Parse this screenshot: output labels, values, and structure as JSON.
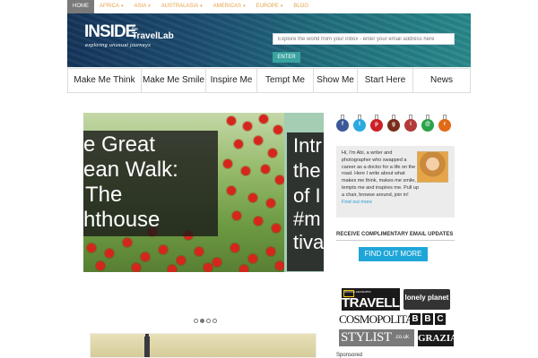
{
  "topnav": {
    "items": [
      {
        "label": "HOME",
        "has_dropdown": false,
        "active": true
      },
      {
        "label": "AFRICA",
        "has_dropdown": true
      },
      {
        "label": "ASIA",
        "has_dropdown": true
      },
      {
        "label": "AUSTRALASIA",
        "has_dropdown": true
      },
      {
        "label": "AMERICAS",
        "has_dropdown": true
      },
      {
        "label": "EUROPE",
        "has_dropdown": true
      },
      {
        "label": "BLOG",
        "has_dropdown": false
      }
    ],
    "dropdown_glyph": "▾"
  },
  "header": {
    "logo_inside": "INSIDE",
    "logo_the": "the",
    "logo_travellab": "TravelLab",
    "logo_tagline": "exploring unusual journeys",
    "email_placeholder": "Explore the world from your inbox - enter your email address here",
    "enter_label": "ENTER"
  },
  "mainnav": {
    "items": [
      {
        "label": "Make Me Think"
      },
      {
        "label": "Make Me Smile"
      },
      {
        "label": "Inspire Me"
      },
      {
        "label": "Tempt Me"
      },
      {
        "label": "Show Me"
      },
      {
        "label": "Start Here"
      },
      {
        "label": "News"
      }
    ]
  },
  "slider": {
    "caption_left_lines": [
      "e Great",
      "ean Walk:",
      "The",
      "hthouse"
    ],
    "caption_right_lines": [
      "Intr",
      "the",
      "of I",
      "#m",
      "tiva"
    ],
    "dots": [
      {
        "active": false
      },
      {
        "active": true
      },
      {
        "active": false
      },
      {
        "active": false
      }
    ]
  },
  "sidebar": {
    "social_icons": [
      {
        "name": "facebook-icon",
        "color": "#3b5998",
        "glyph": "f"
      },
      {
        "name": "twitter-icon",
        "color": "#2ba9e1",
        "glyph": "t"
      },
      {
        "name": "pinterest-icon",
        "color": "#cb2027",
        "glyph": "p"
      },
      {
        "name": "google-plus-icon",
        "color": "#7a2d1a",
        "glyph": "g"
      },
      {
        "name": "instagram-icon",
        "color": "#b33a3a",
        "glyph": "i"
      },
      {
        "name": "email-icon",
        "color": "#2aa24a",
        "glyph": "@"
      },
      {
        "name": "rss-icon",
        "color": "#e06a17",
        "glyph": "r"
      }
    ],
    "bio_text": "Hi, I'm Abi, a writer and photographer who swapped a career as a doctor for a life on the road. Here I write about what makes me think, makes me smile, tempts me and inspires me. Pull up a chair, browse around, join in! ",
    "bio_link": "Find out more",
    "subscribe_heading": "RECEIVE COMPLIMENTARY EMAIL UPDATES",
    "find_out_more": "FIND OUT MORE",
    "press": {
      "natgeo_small": "NATIONAL GEOGRAPHIC",
      "traveller": "TRAVELLER",
      "lonely_planet": "lonely planet",
      "cosmopolitan": "COSMOPOLITAN",
      "bbc": "BBC",
      "stylist": "STYLIST",
      "stylist_suffix": ".co.uk",
      "grazia": "GRAZIA"
    },
    "sponsored_label": "Sponsored"
  }
}
